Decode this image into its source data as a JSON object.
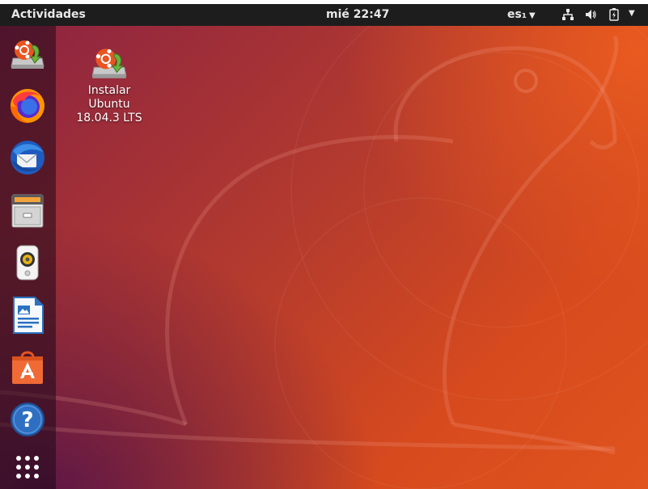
{
  "topbar": {
    "activities_label": "Actividades",
    "clock": "mié 22:47",
    "language": "es₁",
    "icons": [
      "network-icon",
      "volume-icon",
      "battery-icon",
      "system-menu-arrow-icon"
    ]
  },
  "dock": {
    "items": [
      {
        "name": "install-ubuntu",
        "icon": "installer-icon"
      },
      {
        "name": "firefox",
        "icon": "firefox-icon"
      },
      {
        "name": "thunderbird",
        "icon": "thunderbird-icon"
      },
      {
        "name": "files",
        "icon": "files-cabinet-icon"
      },
      {
        "name": "rhythmbox",
        "icon": "speaker-icon"
      },
      {
        "name": "libreoffice-writer",
        "icon": "writer-icon"
      },
      {
        "name": "ubuntu-software",
        "icon": "software-bag-icon"
      },
      {
        "name": "help",
        "icon": "help-icon"
      },
      {
        "name": "show-applications",
        "icon": "app-grid-icon"
      }
    ]
  },
  "desktop": {
    "icons": [
      {
        "label": "Instalar\nUbuntu\n18.04.3 LTS",
        "icon": "installer-icon"
      }
    ]
  },
  "colors": {
    "topbar": "#1d1d1d",
    "wallpaper_orange": "#e0541e",
    "wallpaper_purple": "#7a1f45"
  }
}
